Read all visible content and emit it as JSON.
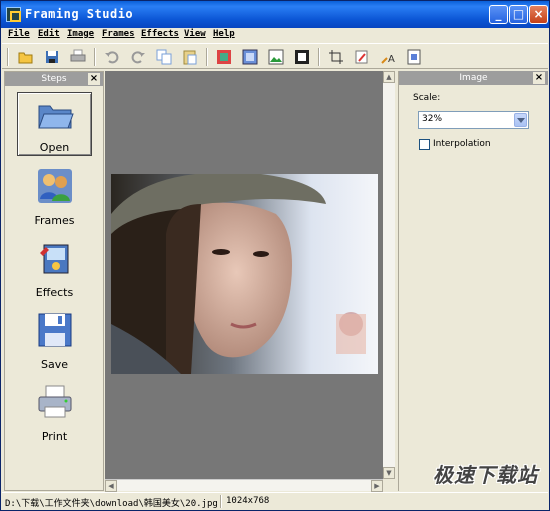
{
  "window": {
    "title": "Framing Studio"
  },
  "menu": [
    "File",
    "Edit",
    "Image",
    "Frames",
    "Effects",
    "View",
    "Help"
  ],
  "toolbar": {
    "icons": [
      "open-icon",
      "save-icon",
      "print-icon",
      "undo-icon",
      "redo-icon",
      "copy-icon",
      "paste-icon",
      "frame-icon",
      "image-icon",
      "picture-icon",
      "border-icon",
      "crop-icon",
      "rotate-icon",
      "text-icon",
      "resize-icon"
    ]
  },
  "steps_panel": {
    "title": "Steps",
    "items": [
      {
        "label": "Open",
        "icon": "folder-icon",
        "selected": true
      },
      {
        "label": "Frames",
        "icon": "people-icon",
        "selected": false
      },
      {
        "label": "Effects",
        "icon": "effects-icon",
        "selected": false
      },
      {
        "label": "Save",
        "icon": "floppy-disk-icon",
        "selected": false
      },
      {
        "label": "Print",
        "icon": "printer-icon",
        "selected": false
      }
    ]
  },
  "image_panel": {
    "title": "Image",
    "scale_label": "Scale:",
    "scale_value": "32%",
    "interpolation_label": "Interpolation",
    "interpolation_checked": false
  },
  "status": {
    "path": "D:\\下载\\工作文件夹\\download\\韩国美女\\20.jpg",
    "dimensions": "1024x768"
  },
  "watermark": "极速下载站",
  "colors": {
    "titlebar": "#0a5fd8",
    "canvas": "#777777",
    "panel_header": "#9d9d9d"
  }
}
